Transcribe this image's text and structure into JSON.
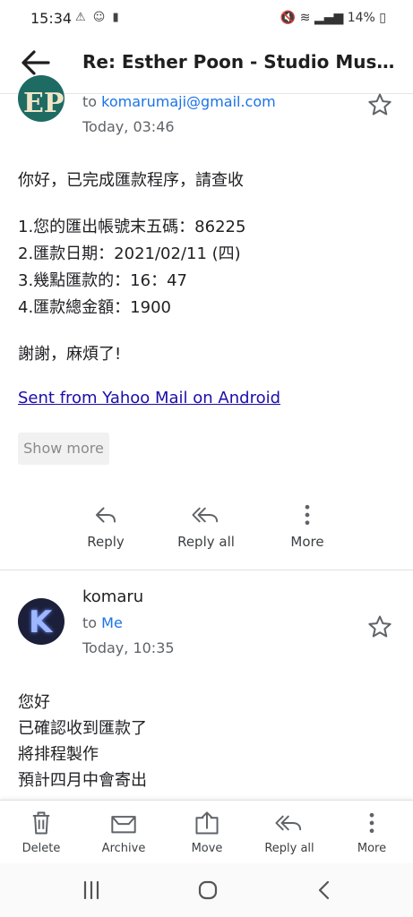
{
  "status_bar": {
    "time": "15:34",
    "left_icons": "⚠ ☺ ▮",
    "battery": "14%"
  },
  "header": {
    "subject": "Re: Esther Poon - Studio Musa..."
  },
  "message1": {
    "avatar_initials": "EP",
    "to_prefix": "to",
    "recipient": "komarumaji@gmail.com",
    "date": "Today, 03:46",
    "body_lines": [
      "你好，已完成匯款程序，請查收",
      "1.您的匯出帳號末五碼：86225",
      "2.匯款日期：2021/02/11 (四)",
      "3.幾點匯款的：16：47",
      "4.匯款總金額：1900",
      "謝謝，麻煩了!"
    ],
    "signature_link": "Sent from Yahoo Mail on Android",
    "show_more": "Show more",
    "actions": {
      "reply": "Reply",
      "reply_all": "Reply all",
      "more": "More"
    }
  },
  "message2": {
    "avatar_initial": "K",
    "sender": "komaru",
    "to_prefix": "to",
    "recipient": "Me",
    "date": "Today, 10:35",
    "body_lines": [
      "您好",
      "已確認收到匯款了",
      "將排程製作",
      "預計四月中會寄出"
    ]
  },
  "toolbar": {
    "delete": "Delete",
    "archive": "Archive",
    "move": "Move",
    "reply_all": "Reply all",
    "more": "More"
  },
  "colors": {
    "link": "#1a73e8",
    "signature_link": "#1a0dab",
    "avatar1_bg": "#1e6b64",
    "avatar2_bg": "#1b1f3a"
  }
}
